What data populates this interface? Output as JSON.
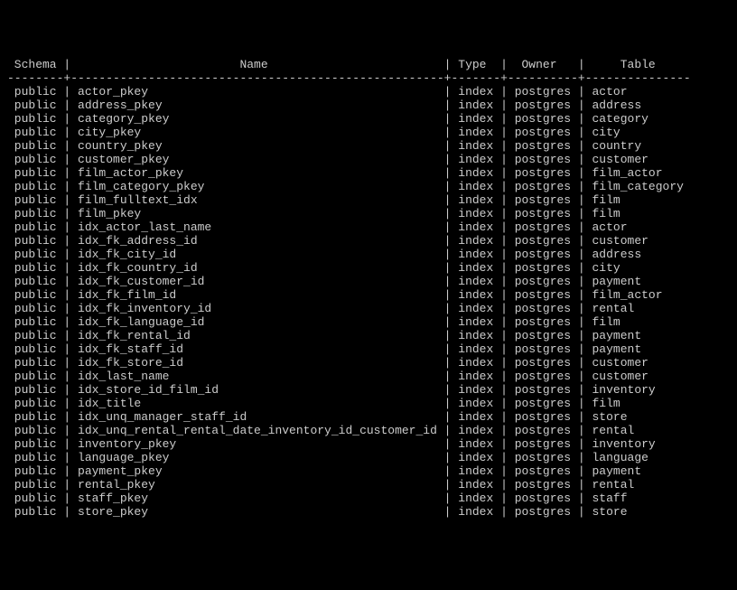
{
  "columns": {
    "schema": "Schema",
    "name": "Name",
    "type": "Type",
    "owner": "Owner",
    "table": "Table"
  },
  "rows": [
    {
      "schema": "public",
      "name": "actor_pkey",
      "type": "index",
      "owner": "postgres",
      "table": "actor"
    },
    {
      "schema": "public",
      "name": "address_pkey",
      "type": "index",
      "owner": "postgres",
      "table": "address"
    },
    {
      "schema": "public",
      "name": "category_pkey",
      "type": "index",
      "owner": "postgres",
      "table": "category"
    },
    {
      "schema": "public",
      "name": "city_pkey",
      "type": "index",
      "owner": "postgres",
      "table": "city"
    },
    {
      "schema": "public",
      "name": "country_pkey",
      "type": "index",
      "owner": "postgres",
      "table": "country"
    },
    {
      "schema": "public",
      "name": "customer_pkey",
      "type": "index",
      "owner": "postgres",
      "table": "customer"
    },
    {
      "schema": "public",
      "name": "film_actor_pkey",
      "type": "index",
      "owner": "postgres",
      "table": "film_actor"
    },
    {
      "schema": "public",
      "name": "film_category_pkey",
      "type": "index",
      "owner": "postgres",
      "table": "film_category"
    },
    {
      "schema": "public",
      "name": "film_fulltext_idx",
      "type": "index",
      "owner": "postgres",
      "table": "film"
    },
    {
      "schema": "public",
      "name": "film_pkey",
      "type": "index",
      "owner": "postgres",
      "table": "film"
    },
    {
      "schema": "public",
      "name": "idx_actor_last_name",
      "type": "index",
      "owner": "postgres",
      "table": "actor"
    },
    {
      "schema": "public",
      "name": "idx_fk_address_id",
      "type": "index",
      "owner": "postgres",
      "table": "customer"
    },
    {
      "schema": "public",
      "name": "idx_fk_city_id",
      "type": "index",
      "owner": "postgres",
      "table": "address"
    },
    {
      "schema": "public",
      "name": "idx_fk_country_id",
      "type": "index",
      "owner": "postgres",
      "table": "city"
    },
    {
      "schema": "public",
      "name": "idx_fk_customer_id",
      "type": "index",
      "owner": "postgres",
      "table": "payment"
    },
    {
      "schema": "public",
      "name": "idx_fk_film_id",
      "type": "index",
      "owner": "postgres",
      "table": "film_actor"
    },
    {
      "schema": "public",
      "name": "idx_fk_inventory_id",
      "type": "index",
      "owner": "postgres",
      "table": "rental"
    },
    {
      "schema": "public",
      "name": "idx_fk_language_id",
      "type": "index",
      "owner": "postgres",
      "table": "film"
    },
    {
      "schema": "public",
      "name": "idx_fk_rental_id",
      "type": "index",
      "owner": "postgres",
      "table": "payment"
    },
    {
      "schema": "public",
      "name": "idx_fk_staff_id",
      "type": "index",
      "owner": "postgres",
      "table": "payment"
    },
    {
      "schema": "public",
      "name": "idx_fk_store_id",
      "type": "index",
      "owner": "postgres",
      "table": "customer"
    },
    {
      "schema": "public",
      "name": "idx_last_name",
      "type": "index",
      "owner": "postgres",
      "table": "customer"
    },
    {
      "schema": "public",
      "name": "idx_store_id_film_id",
      "type": "index",
      "owner": "postgres",
      "table": "inventory"
    },
    {
      "schema": "public",
      "name": "idx_title",
      "type": "index",
      "owner": "postgres",
      "table": "film"
    },
    {
      "schema": "public",
      "name": "idx_unq_manager_staff_id",
      "type": "index",
      "owner": "postgres",
      "table": "store"
    },
    {
      "schema": "public",
      "name": "idx_unq_rental_rental_date_inventory_id_customer_id",
      "type": "index",
      "owner": "postgres",
      "table": "rental"
    },
    {
      "schema": "public",
      "name": "inventory_pkey",
      "type": "index",
      "owner": "postgres",
      "table": "inventory"
    },
    {
      "schema": "public",
      "name": "language_pkey",
      "type": "index",
      "owner": "postgres",
      "table": "language"
    },
    {
      "schema": "public",
      "name": "payment_pkey",
      "type": "index",
      "owner": "postgres",
      "table": "payment"
    },
    {
      "schema": "public",
      "name": "rental_pkey",
      "type": "index",
      "owner": "postgres",
      "table": "rental"
    },
    {
      "schema": "public",
      "name": "staff_pkey",
      "type": "index",
      "owner": "postgres",
      "table": "staff"
    },
    {
      "schema": "public",
      "name": "store_pkey",
      "type": "index",
      "owner": "postgres",
      "table": "store"
    }
  ],
  "widths": {
    "schema": 8,
    "name": 53,
    "type": 7,
    "owner": 10,
    "table": 15
  }
}
